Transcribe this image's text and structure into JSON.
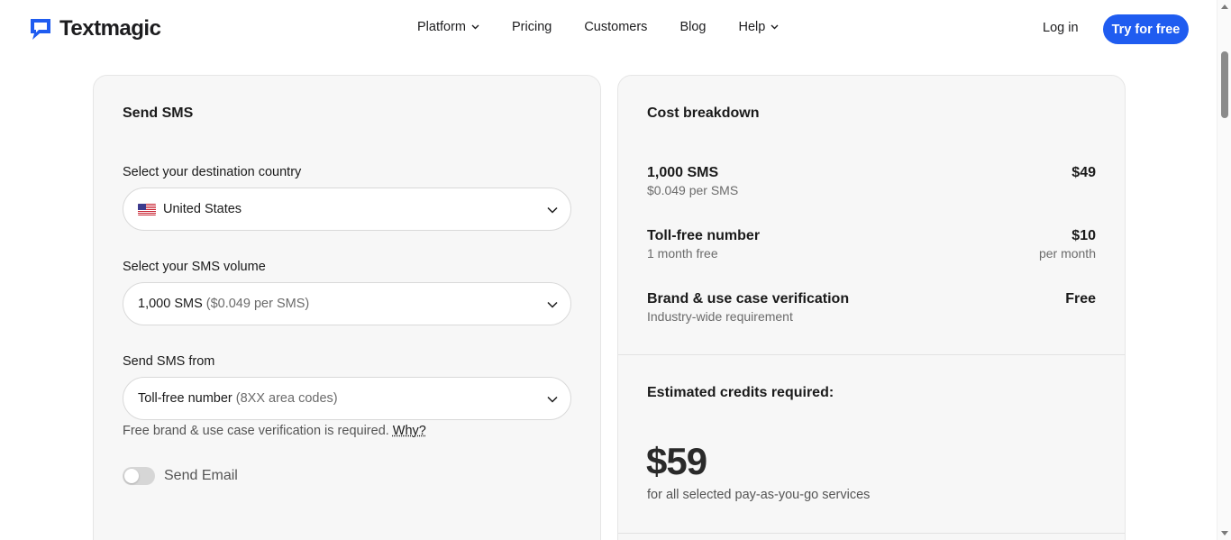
{
  "brand": {
    "name": "Textmagic",
    "accent": "#1f5cf0"
  },
  "nav": {
    "items": [
      {
        "label": "Platform",
        "has_dropdown": true
      },
      {
        "label": "Pricing",
        "has_dropdown": false
      },
      {
        "label": "Customers",
        "has_dropdown": false
      },
      {
        "label": "Blog",
        "has_dropdown": false
      },
      {
        "label": "Help",
        "has_dropdown": true
      }
    ],
    "login": "Log in",
    "cta": "Try for free"
  },
  "send_panel": {
    "title": "Send SMS",
    "country": {
      "label": "Select your destination country",
      "value": "United States",
      "flag_icon": "us-flag-icon"
    },
    "volume": {
      "label": "Select your SMS volume",
      "value": "1,000 SMS",
      "detail": "($0.049 per SMS)"
    },
    "from": {
      "label": "Send SMS from",
      "value": "Toll-free number",
      "detail": "(8XX area codes)"
    },
    "note": {
      "text": "Free brand & use case verification is required.",
      "link": "Why?"
    },
    "email_toggle": {
      "label": "Send Email",
      "enabled": false
    }
  },
  "cost_panel": {
    "title": "Cost breakdown",
    "rows": [
      {
        "name": "1,000 SMS",
        "sub": "$0.049 per SMS",
        "price": "$49",
        "price_sub": ""
      },
      {
        "name": "Toll-free number",
        "sub": "1 month free",
        "price": "$10",
        "price_sub": "per month"
      },
      {
        "name": "Brand & use case verification",
        "sub": "Industry-wide requirement",
        "price": "Free",
        "price_sub": ""
      }
    ],
    "estimate": {
      "title": "Estimated credits required:",
      "amount": "$59",
      "sub": "for all selected pay-as-you-go services"
    }
  }
}
